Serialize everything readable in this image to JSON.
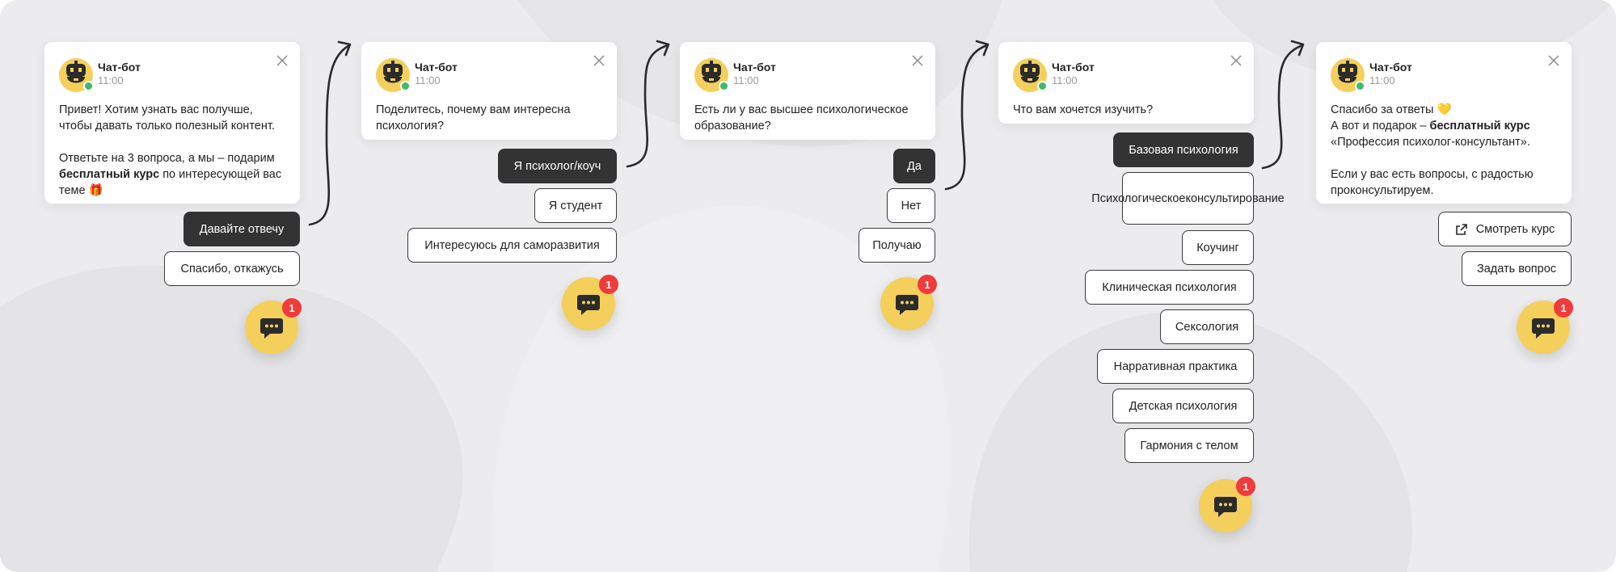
{
  "bot": {
    "name": "Чат-бот",
    "time": "11:00"
  },
  "steps": [
    {
      "lines": [
        [
          "Привет! Хотим узнать вас получше,",
          "чтобы давать только полезный контент."
        ],
        [
          "Ответьте на 3 вопроса, а мы – подарим"
        ]
      ],
      "bold_part": "бесплатный курс",
      "after_bold": " по интересующей вас",
      "last_line": "теме 🎁",
      "options": [
        "Давайте отвечу",
        "Спасибо, откажусь"
      ],
      "badge": "1"
    },
    {
      "text": [
        "Поделитесь, почему вам интересна",
        "психология?"
      ],
      "options": [
        "Я психолог/коуч",
        "Я студент",
        "Интересуюсь для саморазвития"
      ],
      "badge": "1"
    },
    {
      "text": [
        "Есть ли у вас высшее психологическое",
        "образование?"
      ],
      "options": [
        "Да",
        "Нет",
        "Получаю"
      ],
      "badge": "1"
    },
    {
      "text": [
        "Что вам хочется изучить?"
      ],
      "options": [
        "Базовая психология",
        "Психологическое консультирование",
        "Коучинг",
        "Клиническая психология",
        "Сексология",
        "Нарративная практика",
        "Детская психология",
        "Гармония с телом"
      ],
      "badge": "1"
    },
    {
      "line1": "Спасибо за ответы 💛",
      "line2_pre": "А вот и подарок – ",
      "line2_bold": "бесплатный курс",
      "line3": "«Профессия психолог-консультант».",
      "para2": [
        "Если у вас есть вопросы, с радостью",
        "проконсультируем."
      ],
      "options": [
        "Смотреть курс",
        "Задать вопрос"
      ],
      "badge": "1"
    }
  ],
  "option4_1_lines": [
    "Психологическое",
    "консультирование"
  ],
  "icons": {
    "avatar": "robot-avatar-icon",
    "close": "close-icon",
    "chat": "chat-bubble-icon",
    "external": "external-link-icon"
  },
  "colors": {
    "accent": "#f4cf5b",
    "dark_button": "#333333",
    "badge": "#f03b3b",
    "online": "#3dbb6a",
    "background": "#ececee"
  }
}
